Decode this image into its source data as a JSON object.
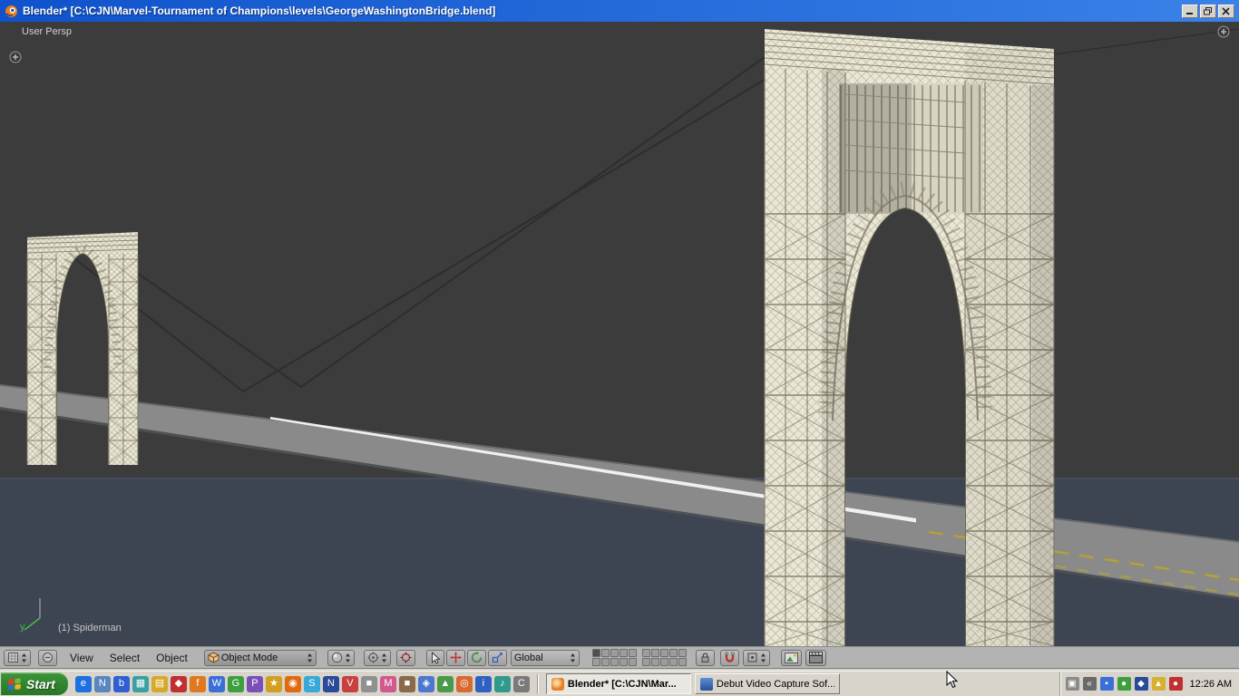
{
  "window": {
    "title": "Blender* [C:\\CJN\\Marvel-Tournament of Champions\\levels\\GeorgeWashingtonBridge.blend]"
  },
  "viewport": {
    "view_label": "User Persp",
    "object_info": "(1) Spiderman",
    "axis_label": "y"
  },
  "header": {
    "menus": [
      {
        "label": "View"
      },
      {
        "label": "Select"
      },
      {
        "label": "Object"
      }
    ],
    "mode_dropdown": {
      "label": "Object Mode"
    },
    "orientation_dropdown": {
      "label": "Global"
    },
    "layers": {
      "groups": 2,
      "per_group": 10,
      "active_index": 0
    }
  },
  "taskbar": {
    "start_label": "Start",
    "tasks": [
      {
        "label": "Blender* [C:\\CJN\\Mar...",
        "active": true
      },
      {
        "label": "Debut Video Capture Sof...",
        "active": false
      }
    ],
    "clock": "12:26 AM",
    "quicklaunch": [
      {
        "color": "#1e6fe0",
        "glyph": "e"
      },
      {
        "color": "#5a86c0",
        "glyph": "N"
      },
      {
        "color": "#2f5fd0",
        "glyph": "b"
      },
      {
        "color": "#3aa0a0",
        "glyph": "▦"
      },
      {
        "color": "#d8a828",
        "glyph": "▤"
      },
      {
        "color": "#c03030",
        "glyph": "◆"
      },
      {
        "color": "#e07820",
        "glyph": "f"
      },
      {
        "color": "#3a6fd8",
        "glyph": "W"
      },
      {
        "color": "#3f9f3f",
        "glyph": "G"
      },
      {
        "color": "#7a4fb8",
        "glyph": "P"
      },
      {
        "color": "#d0a020",
        "glyph": "★"
      },
      {
        "color": "#e06a10",
        "glyph": "◉"
      },
      {
        "color": "#38a8d8",
        "glyph": "S"
      },
      {
        "color": "#2a4a9a",
        "glyph": "N"
      },
      {
        "color": "#c84040",
        "glyph": "V"
      },
      {
        "color": "#909090",
        "glyph": "■"
      },
      {
        "color": "#d05a90",
        "glyph": "M"
      },
      {
        "color": "#8a6a4a",
        "glyph": "■"
      },
      {
        "color": "#4a78d0",
        "glyph": "◈"
      },
      {
        "color": "#4a9a4a",
        "glyph": "▲"
      },
      {
        "color": "#d86a30",
        "glyph": "◎"
      },
      {
        "color": "#3060c0",
        "glyph": "i"
      },
      {
        "color": "#2f9a8a",
        "glyph": "♪"
      },
      {
        "color": "#7a7a7a",
        "glyph": "C"
      }
    ],
    "tray_icons": [
      {
        "color": "#8a8a8a",
        "glyph": "▣"
      },
      {
        "color": "#6a6a6a",
        "glyph": "«"
      },
      {
        "color": "#3a6fd8",
        "glyph": "▪"
      },
      {
        "color": "#3f9f3f",
        "glyph": "●"
      },
      {
        "color": "#2a4a9a",
        "glyph": "◆"
      },
      {
        "color": "#d8b030",
        "glyph": "▲"
      },
      {
        "color": "#c03030",
        "glyph": "●"
      }
    ]
  },
  "colors": {
    "background": "#3c3c3c",
    "water": "#3d4452",
    "road": "#8a8a8a",
    "road_stripe": "#f0f0f0",
    "road_dash": "#b3a233",
    "tower": "#eae7d6",
    "tower_line": "#8d8974",
    "cable": "#2e2e2e",
    "titlebar_start": "#0f52cc",
    "titlebar_end": "#3a82e8",
    "header_bg": "#b3b3b3",
    "taskbar_bg": "#d8d4cb",
    "start_green": "#3a9736",
    "axis_y": "#49b849"
  }
}
